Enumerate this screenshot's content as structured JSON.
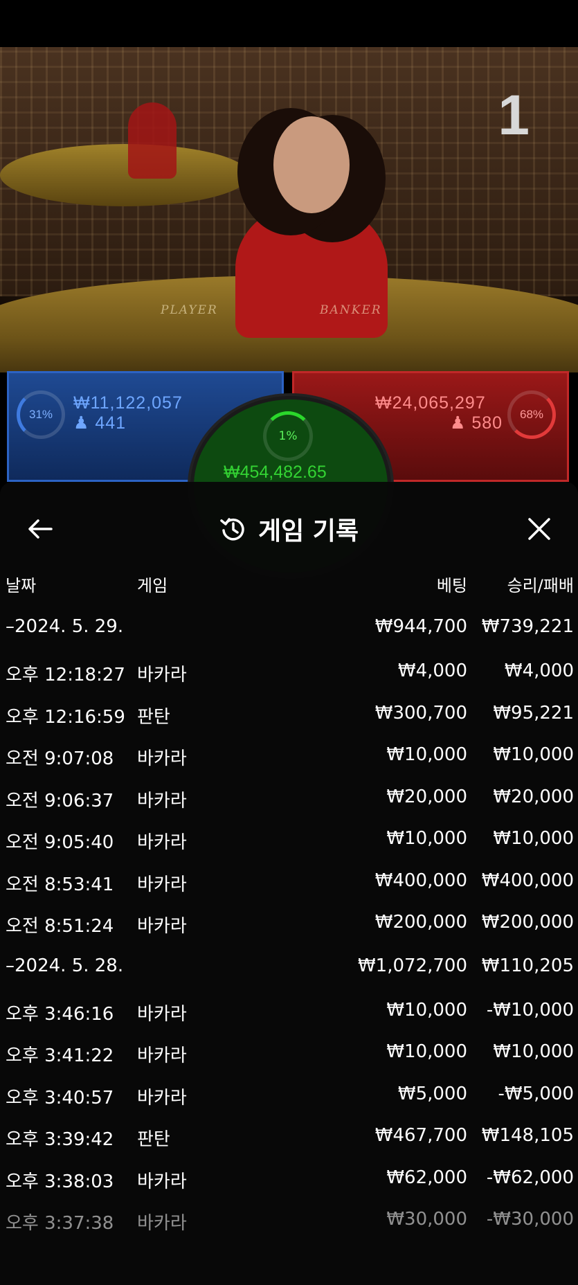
{
  "video": {
    "round_number": "1",
    "table_labels": {
      "player": "PLAYER",
      "banker": "BANKER"
    }
  },
  "stats": {
    "player": {
      "percent": "31%",
      "amount": "₩11,122,057",
      "players": "441"
    },
    "banker": {
      "percent": "68%",
      "amount": "₩24,065,297",
      "players": "580"
    },
    "tie": {
      "percent": "1%",
      "amount": "₩454,482.65"
    }
  },
  "colors": {
    "player": "#2c63c4",
    "banker": "#c02828",
    "tie": "#1f8a1f"
  },
  "history": {
    "title": "게임 기록",
    "icons": {
      "back": "back-arrow-icon",
      "history": "history-icon",
      "close": "close-icon"
    },
    "columns": {
      "date": "날짜",
      "game": "게임",
      "bet": "베팅",
      "result": "승리/패배"
    },
    "rows": [
      {
        "type": "date",
        "time": "–2024. 5. 29.",
        "game": "",
        "bet": "₩944,700",
        "result": "₩739,221"
      },
      {
        "type": "entry",
        "time": "오후 12:18:27",
        "game": "바카라",
        "bet": "₩4,000",
        "result": "₩4,000"
      },
      {
        "type": "entry",
        "time": "오후 12:16:59",
        "game": "판탄",
        "bet": "₩300,700",
        "result": "₩95,221"
      },
      {
        "type": "entry",
        "time": "오전 9:07:08",
        "game": "바카라",
        "bet": "₩10,000",
        "result": "₩10,000"
      },
      {
        "type": "entry",
        "time": "오전 9:06:37",
        "game": "바카라",
        "bet": "₩20,000",
        "result": "₩20,000"
      },
      {
        "type": "entry",
        "time": "오전 9:05:40",
        "game": "바카라",
        "bet": "₩10,000",
        "result": "₩10,000"
      },
      {
        "type": "entry",
        "time": "오전 8:53:41",
        "game": "바카라",
        "bet": "₩400,000",
        "result": "₩400,000"
      },
      {
        "type": "entry",
        "time": "오전 8:51:24",
        "game": "바카라",
        "bet": "₩200,000",
        "result": "₩200,000"
      },
      {
        "type": "date",
        "time": "–2024. 5. 28.",
        "game": "",
        "bet": "₩1,072,700",
        "result": "₩110,205"
      },
      {
        "type": "entry",
        "time": "오후 3:46:16",
        "game": "바카라",
        "bet": "₩10,000",
        "result": "-₩10,000"
      },
      {
        "type": "entry",
        "time": "오후 3:41:22",
        "game": "바카라",
        "bet": "₩10,000",
        "result": "₩10,000"
      },
      {
        "type": "entry",
        "time": "오후 3:40:57",
        "game": "바카라",
        "bet": "₩5,000",
        "result": "-₩5,000"
      },
      {
        "type": "entry",
        "time": "오후 3:39:42",
        "game": "판탄",
        "bet": "₩467,700",
        "result": "₩148,105"
      },
      {
        "type": "entry",
        "time": "오후 3:38:03",
        "game": "바카라",
        "bet": "₩62,000",
        "result": "-₩62,000"
      },
      {
        "type": "entry",
        "time": "오후 3:37:38",
        "game": "바카라",
        "bet": "₩30,000",
        "result": "-₩30,000"
      }
    ]
  }
}
